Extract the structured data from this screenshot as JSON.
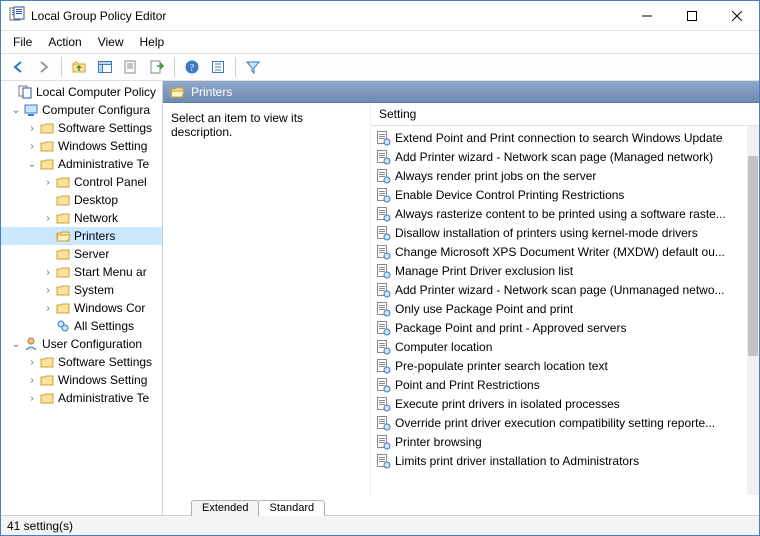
{
  "window": {
    "title": "Local Group Policy Editor"
  },
  "menubar": {
    "items": [
      "File",
      "Action",
      "View",
      "Help"
    ]
  },
  "tree": {
    "root": "Local Computer Policy",
    "computer_conf": "Computer Configura",
    "software_settings": "Software Settings",
    "windows_settings": "Windows Setting",
    "admin_templates": "Administrative Te",
    "control_panel": "Control Panel",
    "desktop": "Desktop",
    "network": "Network",
    "printers": "Printers",
    "server": "Server",
    "start_menu": "Start Menu ar",
    "system": "System",
    "windows_com": "Windows Cor",
    "all_settings": "All Settings",
    "user_conf": "User Configuration",
    "u_software": "Software Settings",
    "u_windows": "Windows Setting",
    "u_admin": "Administrative Te"
  },
  "header": {
    "title": "Printers"
  },
  "description": {
    "placeholder": "Select an item to view its description."
  },
  "list": {
    "column": "Setting",
    "items": [
      "Extend Point and Print connection to search Windows Update",
      "Add Printer wizard - Network scan page (Managed network)",
      "Always render print jobs on the server",
      "Enable Device Control Printing Restrictions",
      "Always rasterize content to be printed using a software raste...",
      "Disallow installation of printers using kernel-mode drivers",
      "Change Microsoft XPS Document Writer (MXDW) default ou...",
      "Manage Print Driver exclusion list",
      "Add Printer wizard - Network scan page (Unmanaged netwo...",
      "Only use Package Point and print",
      "Package Point and print - Approved servers",
      "Computer location",
      "Pre-populate printer search location text",
      "Point and Print Restrictions",
      "Execute print drivers in isolated processes",
      "Override print driver execution compatibility setting reporte...",
      "Printer browsing",
      "Limits print driver installation to Administrators"
    ]
  },
  "tabs": {
    "extended": "Extended",
    "standard": "Standard"
  },
  "status": {
    "text": "41 setting(s)"
  }
}
